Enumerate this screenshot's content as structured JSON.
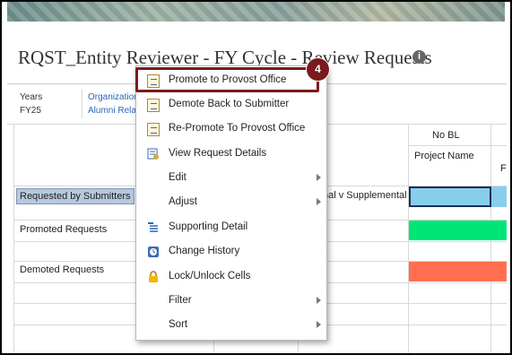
{
  "page": {
    "title": "RQST_Entity Reviewer - FY Cycle - Review Requests"
  },
  "pov": {
    "years_label": "Years",
    "years_value": "FY25",
    "org_label": "Organization",
    "org_value": "Alumni Rela"
  },
  "grid": {
    "col_header_1": "No BL",
    "col_header_2": "Project Name",
    "col_header_3": "F",
    "partial_label": "nal v Supplemental",
    "rows": [
      {
        "label": "Requested by Submitters",
        "color": "#87ceeb"
      },
      {
        "label": "Promoted Requests",
        "color": "#00e676"
      },
      {
        "label": "Demoted Requests",
        "color": "#ff6f4f"
      }
    ]
  },
  "menu": {
    "items": [
      {
        "label": "Promote to Provost Office",
        "icon": "promote-icon"
      },
      {
        "label": "Demote Back to Submitter",
        "icon": "demote-icon"
      },
      {
        "label": "Re-Promote To Provost Office",
        "icon": "repromote-icon"
      },
      {
        "label": "View Request Details",
        "icon": "details-icon"
      },
      {
        "label": "Edit",
        "icon": "",
        "submenu": true
      },
      {
        "label": "Adjust",
        "icon": "",
        "submenu": true
      },
      {
        "label": "Supporting Detail",
        "icon": "supporting-detail-icon"
      },
      {
        "label": "Change History",
        "icon": "history-icon"
      },
      {
        "label": "Lock/Unlock Cells",
        "icon": "lock-icon"
      },
      {
        "label": "Filter",
        "icon": "",
        "submenu": true
      },
      {
        "label": "Sort",
        "icon": "",
        "submenu": true
      }
    ]
  },
  "callout": {
    "number": "4",
    "color": "#7a1a1e"
  }
}
